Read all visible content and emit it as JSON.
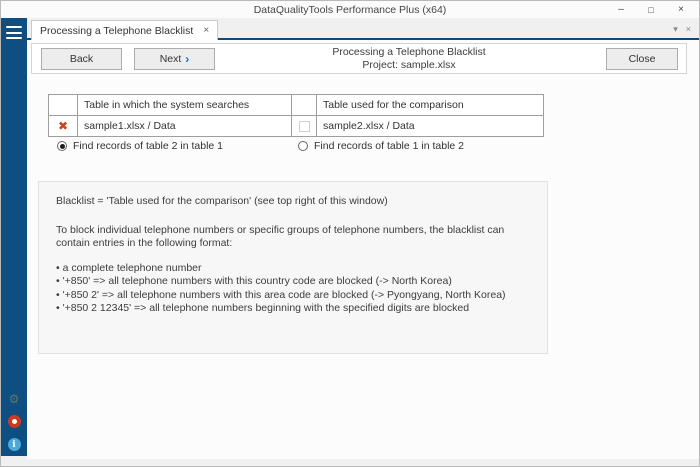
{
  "window": {
    "title": "DataQualityTools Performance Plus (x64)"
  },
  "icons": {
    "minimize": "–",
    "maximize": "□",
    "close": "×",
    "tab_close": "×",
    "tab_overflow": "▾",
    "gear": "⚙",
    "info_letter": "i",
    "delete_x": "✖",
    "next_chevron": "›"
  },
  "tabbar": {
    "active_tab": "Processing a Telephone Blacklist"
  },
  "header": {
    "back_label": "Back",
    "next_label": "Next",
    "close_label": "Close",
    "title_line1": "Processing a Telephone Blacklist",
    "title_line2": "Project: sample.xlsx"
  },
  "table": {
    "headers": [
      "",
      "Table in which the system searches",
      "",
      "Table used for the comparison"
    ],
    "row": {
      "search_table": "sample1.xlsx / Data",
      "comparison_table": "sample2.xlsx / Data",
      "checkbox_checked": false
    }
  },
  "radios": [
    {
      "label": "Find records of table 2 in table 1",
      "selected": true
    },
    {
      "label": "Find records of table 1 in table 2",
      "selected": false
    }
  ],
  "info_box": {
    "line1": "Blacklist = 'Table used for the comparison' (see top right of this window)",
    "line2": "To block individual telephone numbers or specific groups of telephone numbers, the blacklist can contain entries in the following format:",
    "bullets": [
      "• a complete telephone number",
      "• '+850' => all telephone numbers with this country code are blocked (-> North Korea)",
      "• '+850 2' => all telephone numbers with this area code are blocked (-> Pyongyang, North Korea)",
      "• '+850 2 12345' => all telephone numbers beginning with the specified digits are blocked"
    ]
  },
  "colors": {
    "sidebar_blue": "#0e4e80",
    "accent_blue": "#0078d7",
    "delete_red": "#d1431f",
    "lifebuoy_red": "#cf3a1e",
    "info_blue": "#4aa8da"
  }
}
